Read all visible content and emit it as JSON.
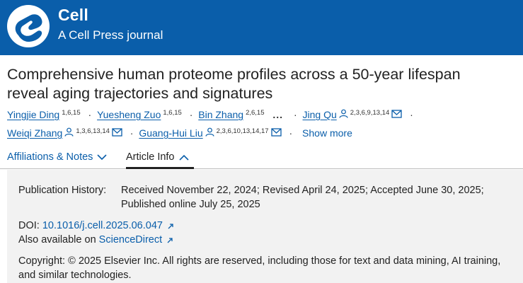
{
  "header": {
    "brand": "Cell",
    "tagline": "A Cell Press journal",
    "colors": {
      "background": "#0a5eaa",
      "text": "#ffffff"
    },
    "logo_icon": "cell-logo-icon"
  },
  "article": {
    "title_line1": "Comprehensive human proteome profiles across a 50-year lifespan",
    "title_line2": "reveal aging trajectories and signatures"
  },
  "authors": [
    {
      "name": "Yingjie Ding",
      "affil": "1,6,15"
    },
    {
      "name": "Yuesheng Zuo",
      "affil": "1,6,15"
    },
    {
      "name": "Bin Zhang",
      "affil": "2,6,15"
    },
    {
      "name": "Jing Qu",
      "affil": "2,3,6,9,13,14",
      "icons": [
        "person-icon",
        "mail-icon"
      ]
    },
    {
      "name": "Weiqi Zhang",
      "affil": "1,3,6,13,14",
      "icons": [
        "person-icon",
        "mail-icon"
      ]
    },
    {
      "name": "Guang-Hui Liu",
      "affil": "2,3,6,10,13,14,17",
      "icons": [
        "person-icon",
        "mail-icon"
      ]
    }
  ],
  "author_list": {
    "separator": "·",
    "ellipsis": "...",
    "show_more": "Show more"
  },
  "tabs": [
    {
      "label": "Affiliations & Notes",
      "icon": "chevron-down-icon",
      "active": false
    },
    {
      "label": "Article Info",
      "icon": "chevron-up-icon",
      "active": true
    }
  ],
  "info": {
    "publication_history_label": "Publication History:",
    "publication_history_line1": "Received November 22, 2024; Revised April 24, 2025; Accepted June 30, 2025;",
    "publication_history_line2": "Published online July 25, 2025",
    "doi_label": "DOI:",
    "doi_value": "10.1016/j.cell.2025.06.047",
    "available_label": "Also available on",
    "available_link": "ScienceDirect",
    "copyright": "Copyright: © 2025 Elsevier Inc. All rights are reserved, including those for text and data mining, AI training, and similar technologies."
  }
}
